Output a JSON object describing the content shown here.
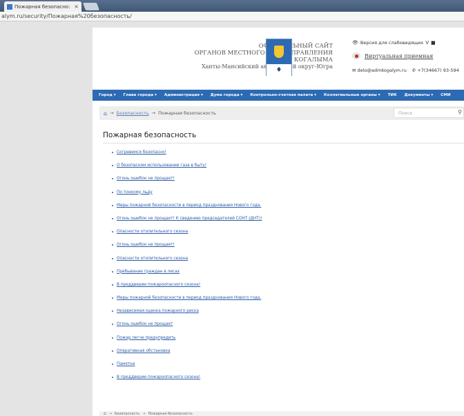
{
  "browser": {
    "tab_title": "Пожарная безопасно:",
    "tab_close": "×",
    "address": "alym.ru/security/Пожарная%20безопасность/"
  },
  "header": {
    "title_line1": "ОФИЦИАЛЬНЫЙ САЙТ",
    "title_line2": "ОРГАНОВ МЕСТНОГО САМОУПРАВЛЕНИЯ",
    "title_line3": "ГОРОДА КОГАЛЫМА",
    "region": "Ханты-Мансийский автономный округ-Югра",
    "vision_label": "Версия для слабовидящих",
    "reception_label": "Виртуальная приемная",
    "email": "delo@admkogalym.ru",
    "phone": "+7(34667) 93-594"
  },
  "nav": {
    "items": [
      "Город ▾",
      "Глава города ▾",
      "Администрация ▾",
      "Дума города ▾",
      "Контрольно-счетная палата ▾",
      "Коллегиальные органы ▾",
      "ТИК",
      "Документы ▾",
      "СМИ"
    ]
  },
  "breadcrumb": {
    "home_icon": "home-icon",
    "arrow": "→",
    "section": "Безопасность",
    "current": "Пожарная безопасность"
  },
  "search": {
    "placeholder": "Поиск"
  },
  "main": {
    "title": "Пожарная безопасность",
    "links": [
      "Согревемся безопасно!",
      "О безопасном использовании газа в быту!",
      "Огонь ошибок не прощает!",
      "По тонкому льду",
      "Меры пожарной безопасности в период празднования Нового года.",
      "Огонь ошибок не прощает! К сведению председателей СОНТ (ДНТ)!",
      "Опасности отопительного сезона",
      "Огонь ошибок не прощает!",
      "Опасности отопительного сезона",
      "Пребывание граждан в лесах",
      "В преддверии пожароопасного сезона!",
      "Меры пожарной безопасности в период празднования Нового года.",
      "Независимая оценка пожарного риска",
      "Огонь ошибок не прощает",
      "Пожар легче предупредить",
      "Оперативная обстановка",
      "Памятки",
      "В преддверии пожароопасного сезона!"
    ]
  },
  "footer": {
    "section": "Безопасность",
    "current": "Пожарная безопасность"
  },
  "colors": {
    "nav_bg": "#2d6ab3",
    "link": "#2a5aa8"
  }
}
